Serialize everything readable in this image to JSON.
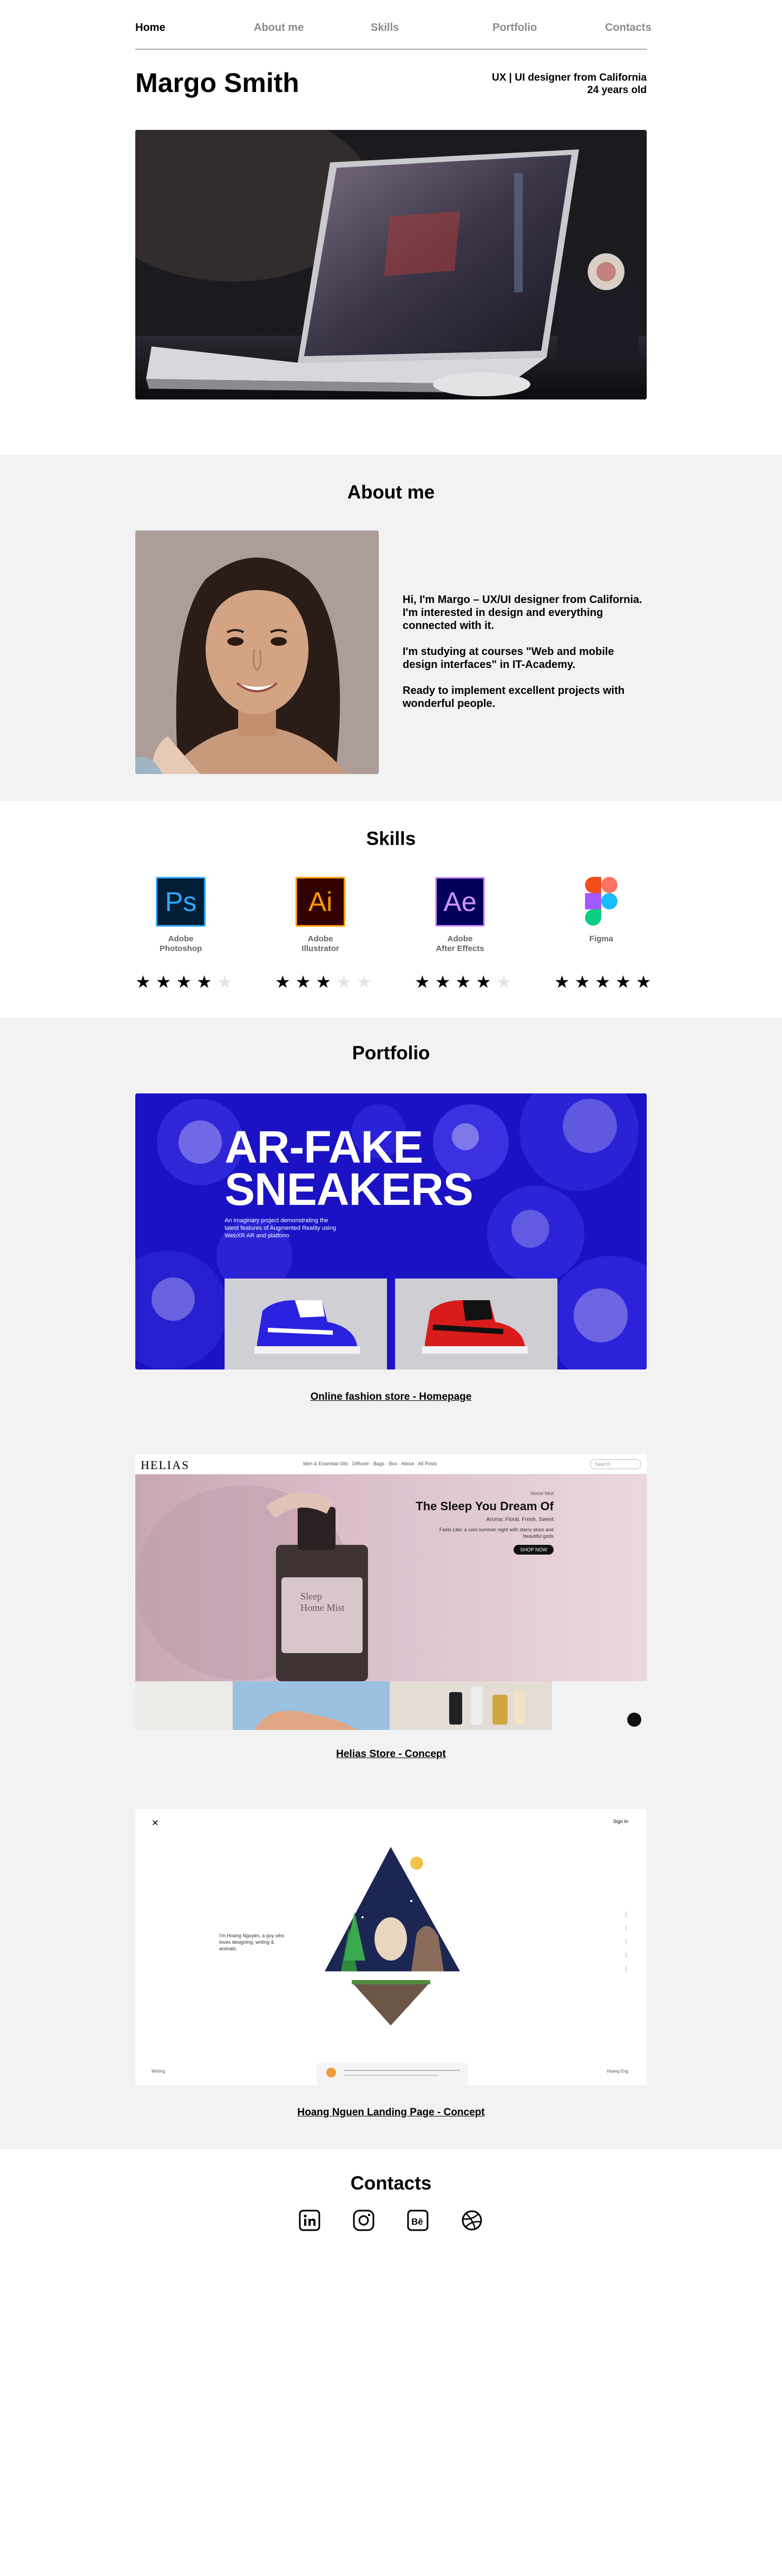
{
  "nav": {
    "home": "Home",
    "about": "About me",
    "skills": "Skills",
    "portfolio": "Portfolio",
    "contacts": "Contacts"
  },
  "header": {
    "name": "Margo Smith",
    "role": "UX | UI designer from California",
    "age": "24 years old"
  },
  "about": {
    "title": "About me",
    "p1": "Hi, I'm Margo – UX/UI designer from California. I'm interested in design and everything connected with it.",
    "p2": "I'm studying at courses \"Web and mobile design interfaces\" in IT-Academy.",
    "p3": "Ready to implement excellent projects with wonderful people."
  },
  "skills": {
    "title": "Skills",
    "items": [
      {
        "abbr": "Ps",
        "name1": "Adobe",
        "name2": "Photoshop",
        "rating": 4,
        "color": "#31a8ff",
        "bg": "#001e36"
      },
      {
        "abbr": "Ai",
        "name1": "Adobe",
        "name2": "Illustrator",
        "rating": 3,
        "color": "#ff9a00",
        "bg": "#330000"
      },
      {
        "abbr": "Ae",
        "name1": "Adobe",
        "name2": "After Effects",
        "rating": 4,
        "color": "#d291ff",
        "bg": "#00005b"
      },
      {
        "abbr": "",
        "name1": "Figma",
        "name2": "",
        "rating": 5,
        "color": "#000000",
        "bg": "#ffffff"
      }
    ]
  },
  "portfolio": {
    "title": "Portfolio",
    "p1": {
      "link": "Online fashion store - Homepage",
      "headline1": "AR-FAKE",
      "headline2": "SNEAKERS",
      "blurb": "An imaginary project demonstrating the latest features of Augmented Reality using WebXR AR and platform"
    },
    "p2": {
      "link": "Helias Store - Concept",
      "brand": "HELIAS",
      "menu": "Men & Essential Oils · Diffuser · Bags · Box · About · All Posts",
      "search": "Search",
      "kicker": "Home Mist",
      "heading": "The Sleep You Dream Of",
      "aroma": "Aroma: Floral, Fresh, Sweet",
      "desc": "Feels Like: a cool summer night with starry skies and beautiful gods",
      "cta": "SHOP NOW",
      "bottle1": "Sleep",
      "bottle2": "Home Mist"
    },
    "p3": {
      "link": "Hoang Nguen Landing Page - Concept",
      "signin": "Sign In",
      "intro": "I'm Hoang Nguyen, a guy who loves designing, writing & animals.",
      "left": "Writing",
      "right": "Hoang Eng"
    }
  },
  "contacts": {
    "title": "Contacts",
    "icons": [
      "linkedin-icon",
      "instagram-icon",
      "behance-icon",
      "dribbble-icon"
    ]
  }
}
